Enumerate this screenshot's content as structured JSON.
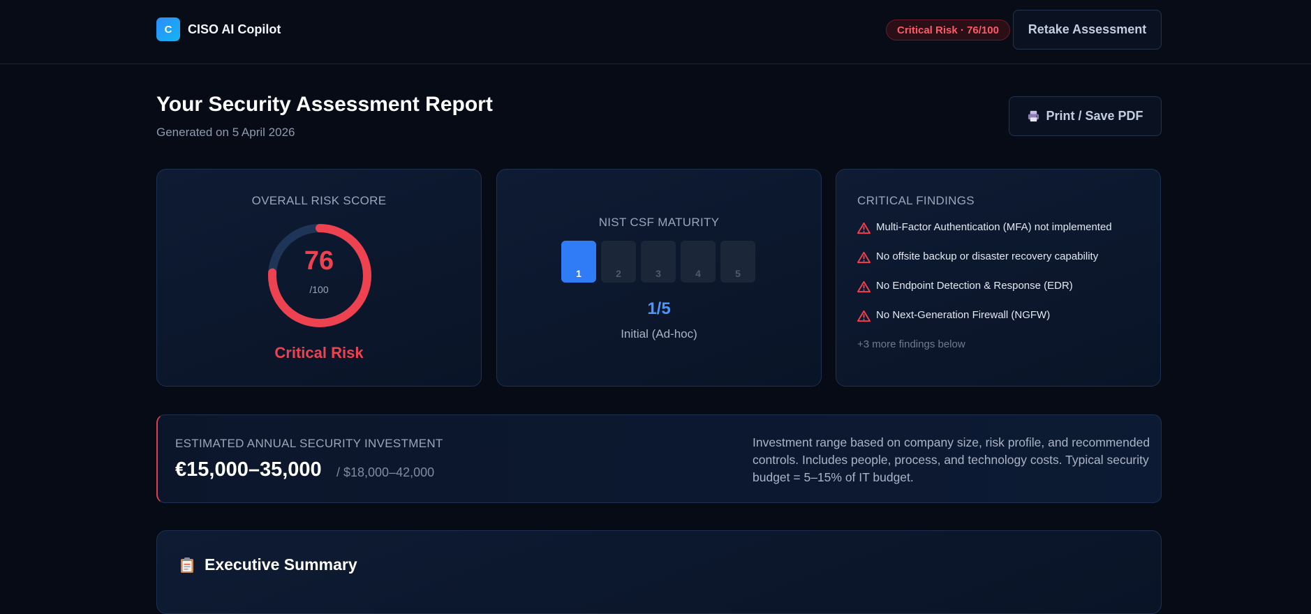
{
  "header": {
    "logo_letter": "C",
    "app_name": "CISO AI Copilot",
    "risk_badge": "Critical Risk · 76/100",
    "retake_label": "Retake Assessment"
  },
  "report": {
    "title": "Your Security Assessment Report",
    "generated": "Generated on 5 April 2026",
    "print_label": "Print / Save PDF"
  },
  "risk_card": {
    "label": "OVERALL RISK SCORE",
    "score": "76",
    "max": "/100",
    "score_fraction": 0.76,
    "level": "Critical Risk",
    "color": "#ef4250",
    "track_color": "#1e3557"
  },
  "nist_card": {
    "label": "NIST CSF MATURITY",
    "levels": [
      "1",
      "2",
      "3",
      "4",
      "5"
    ],
    "current_level": 1,
    "score": "1/5",
    "description": "Initial (Ad-hoc)",
    "accent": "#2f7cf6"
  },
  "findings_card": {
    "label": "CRITICAL FINDINGS",
    "items": [
      "Multi-Factor Authentication (MFA) not implemented",
      "No offsite backup or disaster recovery capability",
      "No Endpoint Detection & Response (EDR)",
      "No Next-Generation Firewall (NGFW)"
    ],
    "more": "+3 more findings below",
    "icon": "warning-triangle-icon"
  },
  "investment": {
    "label": "ESTIMATED ANNUAL SECURITY INVESTMENT",
    "eur": "€15,000–35,000",
    "usd": "/ $18,000–42,000",
    "note": "Investment range based on company size, risk profile, and recommended controls. Includes people, process, and technology costs. Typical security budget = 5–15% of IT budget."
  },
  "summary": {
    "title": "Executive Summary",
    "icon": "clipboard-icon"
  }
}
